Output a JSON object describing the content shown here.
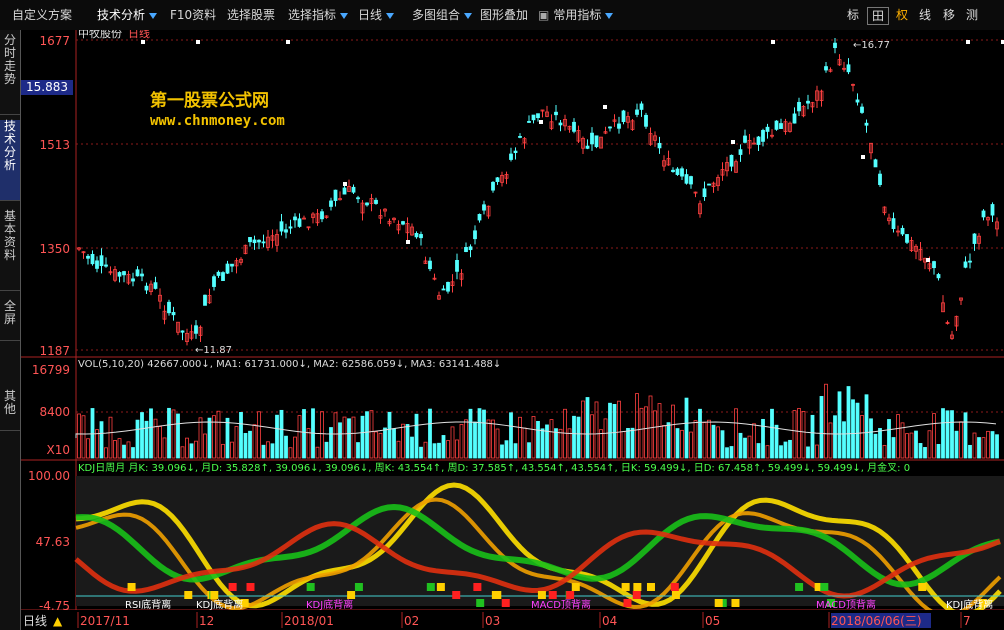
{
  "toolbar": {
    "items": [
      "自定义方案",
      "技术分析",
      "F10资料",
      "选择股票",
      "选择指标",
      "日线",
      "多图组合",
      "图形叠加",
      "常用指标"
    ],
    "right_buttons": [
      "标",
      "田",
      "权",
      "线",
      "移",
      "测"
    ]
  },
  "sidebar": {
    "tabs": [
      "分时走势",
      "技术分析",
      "基本资料",
      "全屏",
      "其他"
    ]
  },
  "main": {
    "stock_name": "中牧股份",
    "period": "日线",
    "price_labels": [
      "1677",
      "1513",
      "1350",
      "1187"
    ],
    "current_price": "15.883",
    "high_marker": "16.77",
    "low_marker": "11.87"
  },
  "watermark": {
    "line1": "第一股票公式网",
    "line2": "www.chnmoney.com"
  },
  "volume": {
    "header": "VOL(5,10,20)  42667.000↓, MA1: 61731.000↓, MA2: 62586.059↓, MA3: 63141.488↓",
    "labels": [
      "16799",
      "8400",
      "X10"
    ]
  },
  "kdj": {
    "header": "KDJ日周月  月K: 39.096↓, 月D: 35.828↑, 39.096↓, 39.096↓, 周K: 43.554↑, 周D: 37.585↑, 43.554↑, 43.554↑, 日K: 59.499↓, 日D: 67.458↑, 59.499↓, 59.499↓, 月金叉: 0",
    "labels": [
      "100.00",
      "47.63",
      "-4.75"
    ],
    "annotations": [
      "RSI底背离",
      "KDJ底背离",
      "KDJ底背离",
      "MACD顶背离",
      "MACD顶背离",
      "KDJ底背离"
    ]
  },
  "bottom": {
    "period_label": "日线",
    "dates": [
      "2017/11",
      "12",
      "2018/01",
      "02",
      "03",
      "04",
      "05",
      "2018/06/06(三)",
      "7"
    ]
  },
  "colors": {
    "up": "#ff4040",
    "down": "#54ffff",
    "grid": "#8b1a1a",
    "label": "#ff5555"
  }
}
